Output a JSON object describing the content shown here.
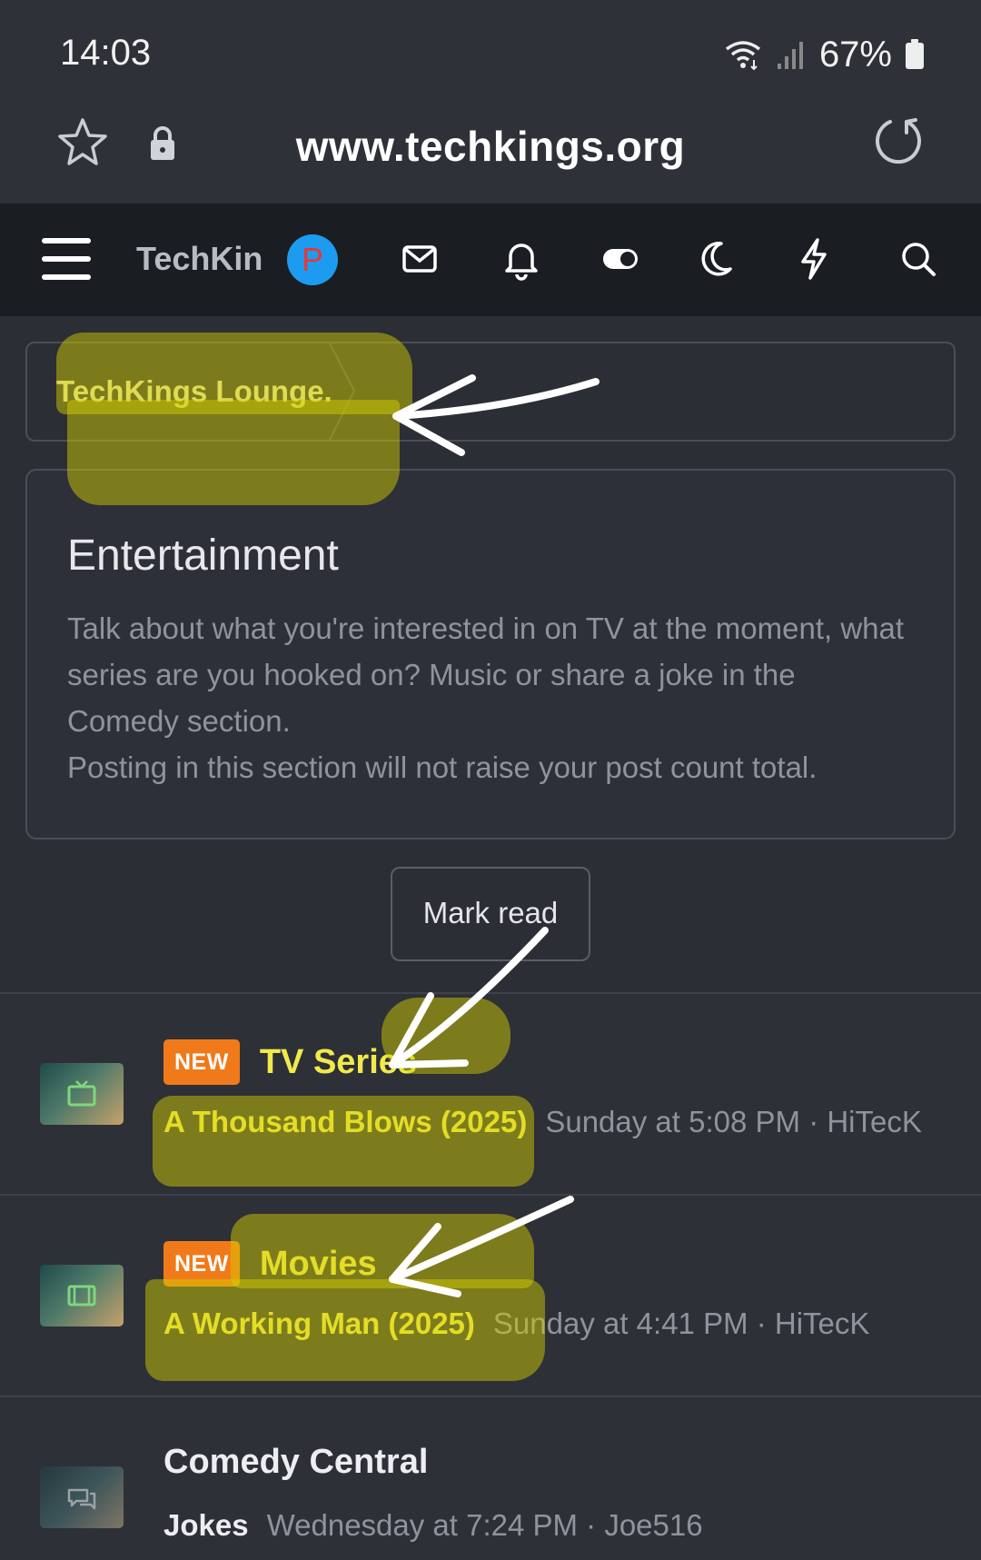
{
  "status_bar": {
    "time": "14:03",
    "battery_percent": "67%"
  },
  "browser": {
    "url": "www.techkings.org"
  },
  "nav": {
    "brand": "TechKin",
    "avatar_letter": "P"
  },
  "breadcrumb": {
    "items": [
      "TechKings Lounge."
    ]
  },
  "forum": {
    "title": "Entertainment",
    "description_lines": [
      "Talk about what you're interested in on TV at the moment, what series are you hooked on? Music or share a joke in the Comedy section.",
      "Posting in this section will not raise your post count total."
    ]
  },
  "mark_read_label": "Mark read",
  "nodes": [
    {
      "badge": "NEW",
      "title": "TV Series",
      "latest_thread": "A Thousand Blows (2025)",
      "latest_meta": "Sunday at 5:08 PM · HiTecK",
      "icon": "tv-icon"
    },
    {
      "badge": "NEW",
      "title": "Movies",
      "latest_thread": "A Working Man (2025)",
      "latest_meta": "Sunday at 4:41 PM · HiTecK",
      "icon": "film-icon"
    },
    {
      "badge": "",
      "title": "Comedy Central",
      "latest_thread": "Jokes",
      "latest_meta": "Wednesday at 7:24 PM · Joe516",
      "icon": "chat-icon"
    }
  ],
  "colors": {
    "accent_yellow": "#f1ea4a",
    "badge_orange": "#f07a1a",
    "avatar_blue": "#1d9bf0",
    "highlighter": "#d6cf00"
  }
}
